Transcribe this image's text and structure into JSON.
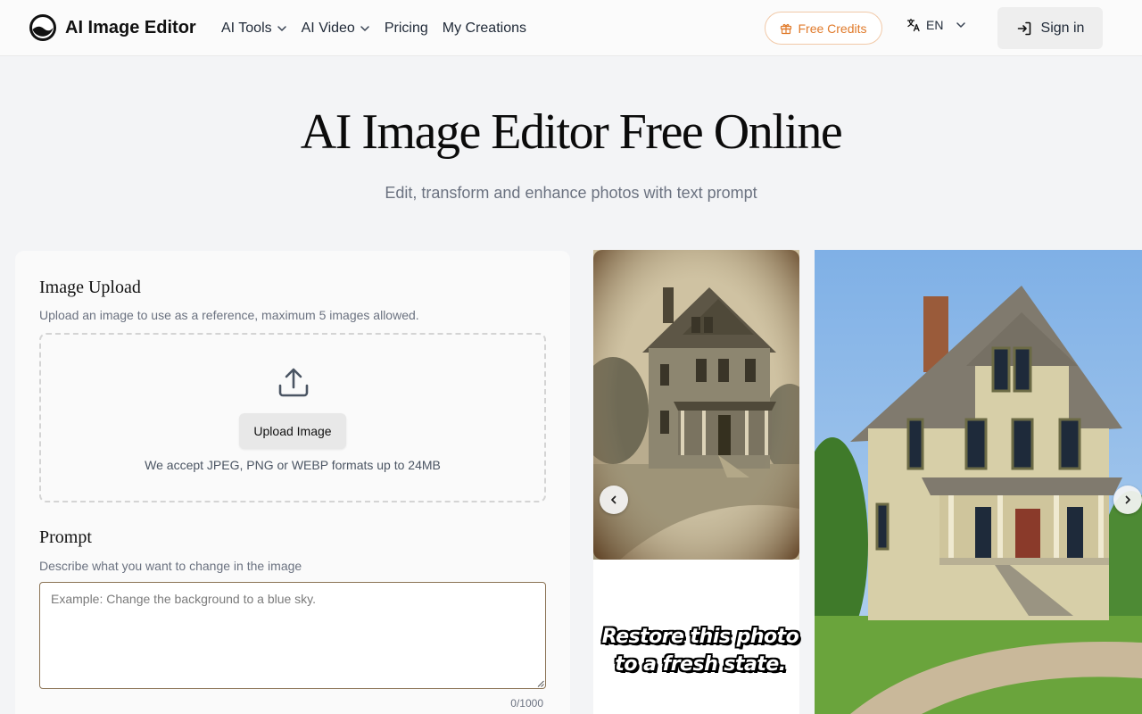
{
  "brand": {
    "name": "AI Image Editor"
  },
  "nav": {
    "items": [
      {
        "label": "AI Tools",
        "has_dropdown": true
      },
      {
        "label": "AI Video",
        "has_dropdown": true
      },
      {
        "label": "Pricing",
        "has_dropdown": false
      },
      {
        "label": "My Creations",
        "has_dropdown": false
      }
    ]
  },
  "header": {
    "credits_label": "Free Credits",
    "language": "EN",
    "signin_label": "Sign in"
  },
  "hero": {
    "title": "AI Image Editor Free Online",
    "subtitle": "Edit, transform and enhance photos with text prompt"
  },
  "upload": {
    "title": "Image Upload",
    "description": "Upload an image to use as a reference, maximum 5 images allowed.",
    "button_label": "Upload Image",
    "accept_note": "We accept JPEG, PNG or WEBP formats up to 24MB"
  },
  "prompt": {
    "title": "Prompt",
    "description": "Describe what you want to change in the image",
    "value": "",
    "placeholder": "Example: Change the background to a blue sky.",
    "counter": "0/1000"
  },
  "showcase": {
    "caption_line1": "Restore this photo",
    "caption_line2": "to a fresh state."
  },
  "colors": {
    "accent_orange": "#e07a2a",
    "page_bg": "#f3f4f6",
    "panel_bg": "#fafafa"
  }
}
